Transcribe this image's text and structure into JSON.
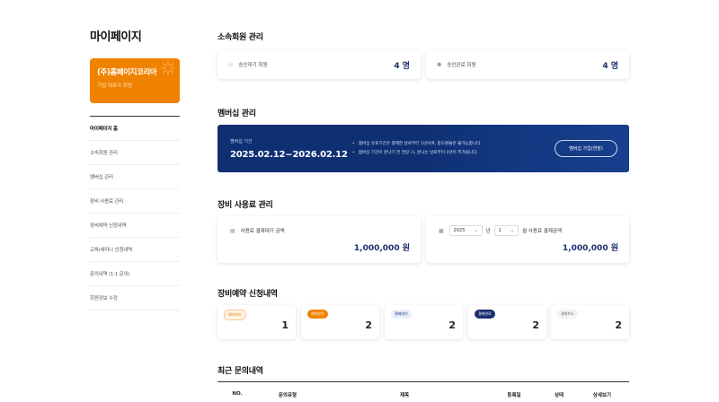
{
  "sidebar": {
    "title": "마이페이지",
    "org": {
      "name": "(주)홈페이지코리아",
      "role": "기업 대표자 회원"
    },
    "items": [
      {
        "label": "마이페이지 홈"
      },
      {
        "label": "소속회원 관리"
      },
      {
        "label": "멤버십 관리"
      },
      {
        "label": "장비 사용료 관리"
      },
      {
        "label": "장비예약 신청내역"
      },
      {
        "label": "교육/세미나 신청내역"
      },
      {
        "label": "문의내역 (1:1 문의)"
      },
      {
        "label": "회원정보 수정"
      }
    ]
  },
  "affiliated": {
    "title": "소속회원 관리",
    "pending": {
      "icon": "user-clock-icon",
      "label": "승인대기 회원",
      "count": "4 명"
    },
    "approved": {
      "icon": "user-check-icon",
      "label": "승인완료 회원",
      "count": "4 명"
    }
  },
  "membership": {
    "title": "멤버십 관리",
    "period_label": "멤버십 기간",
    "period": "2025.02.12~2026.02.12",
    "notes": [
      "멤버십 유효기간은 결제한 날로부터 1년이며, 중도환불은 불가능합니다.",
      "멤버십 기간이 끝나기 전 연장 시, 끝나는 날로부터 1년이 추가됩니다."
    ],
    "button": "멤버십 가입(연장)"
  },
  "equipment_fee": {
    "title": "장비 사용료 관리",
    "pending": {
      "icon": "card-icon",
      "label": "사용료 결제대기 금액",
      "amount": "1,000,000 원"
    },
    "monthly": {
      "icon": "calendar-icon",
      "year": "2025",
      "year_suffix": "년",
      "month": "1",
      "month_suffix": "월 사용료 결제금액",
      "amount": "1,000,000 원"
    }
  },
  "reservations": {
    "title": "장비예약 신청내역",
    "items": [
      {
        "badge": "예약대기",
        "count": "1"
      },
      {
        "badge": "예약승인",
        "count": "2"
      },
      {
        "badge": "결제대기",
        "count": "2"
      },
      {
        "badge": "결제완료",
        "count": "2"
      },
      {
        "badge": "결제취소",
        "count": "2"
      }
    ]
  },
  "inquiries": {
    "title": "최근 문의내역",
    "columns": [
      "NO.",
      "문의유형",
      "제목",
      "등록일",
      "상태",
      "상세보기"
    ]
  },
  "colors": {
    "accent": "#f08200",
    "navy": "#0f2f73",
    "number": "#1b2f6e"
  }
}
